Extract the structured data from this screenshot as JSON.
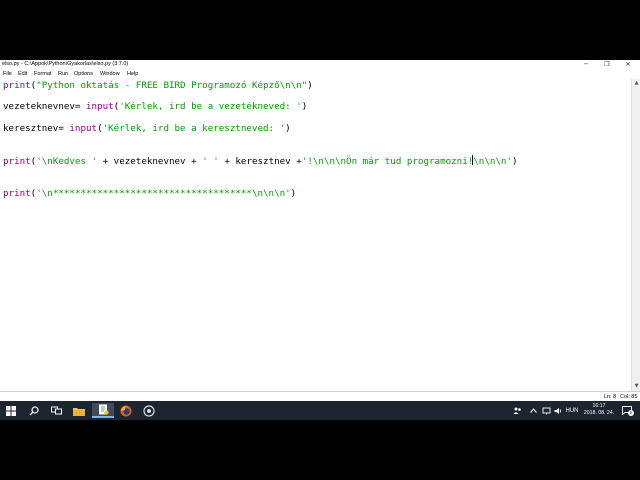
{
  "window": {
    "title": "elso.py - C:\\Appok\\Python\\Gyakorlas\\elso.py (3.7.0)",
    "minimize_icon": "─",
    "maximize_icon": "❐",
    "close_icon": "✕"
  },
  "menu": [
    "File",
    "Edit",
    "Format",
    "Run",
    "Options",
    "Window",
    "Help"
  ],
  "code": {
    "line1": {
      "func": "print",
      "open": "(",
      "str": "\"Python oktatás - FREE BIRD Programozó Képző\\n\\n\"",
      "close": ")"
    },
    "line2": {
      "pre": "vezeteknevnev= ",
      "func": "input",
      "open": "(",
      "str": "'Kérlek, ird be a vezetékneved: '",
      "close": ")"
    },
    "line3": {
      "pre": "keresztnev= ",
      "func": "input",
      "open": "(",
      "str": "'Kérlek, ird be a keresztneved: '",
      "close": ")"
    },
    "line4": {
      "func": "print",
      "open": "(",
      "str1": "'\\nKedves '",
      "mid1": " + vezeteknevnev + ",
      "str2": "' '",
      "mid2": " + keresztnev +",
      "str3a": "'!\\n\\n\\nÖn már tud programozni!",
      "str3b": "\\n\\n\\n'",
      "close": ")"
    },
    "line5": {
      "func": "print",
      "open": "(",
      "str": "'\\n************************************\\n\\n\\n'",
      "close": ")"
    }
  },
  "status": {
    "line": "Ln: 8",
    "col": "Col: 85"
  },
  "taskbar": {
    "language": "HUN",
    "time": "16:17",
    "date": "2018. 08. 24.",
    "notification_count": "2"
  }
}
